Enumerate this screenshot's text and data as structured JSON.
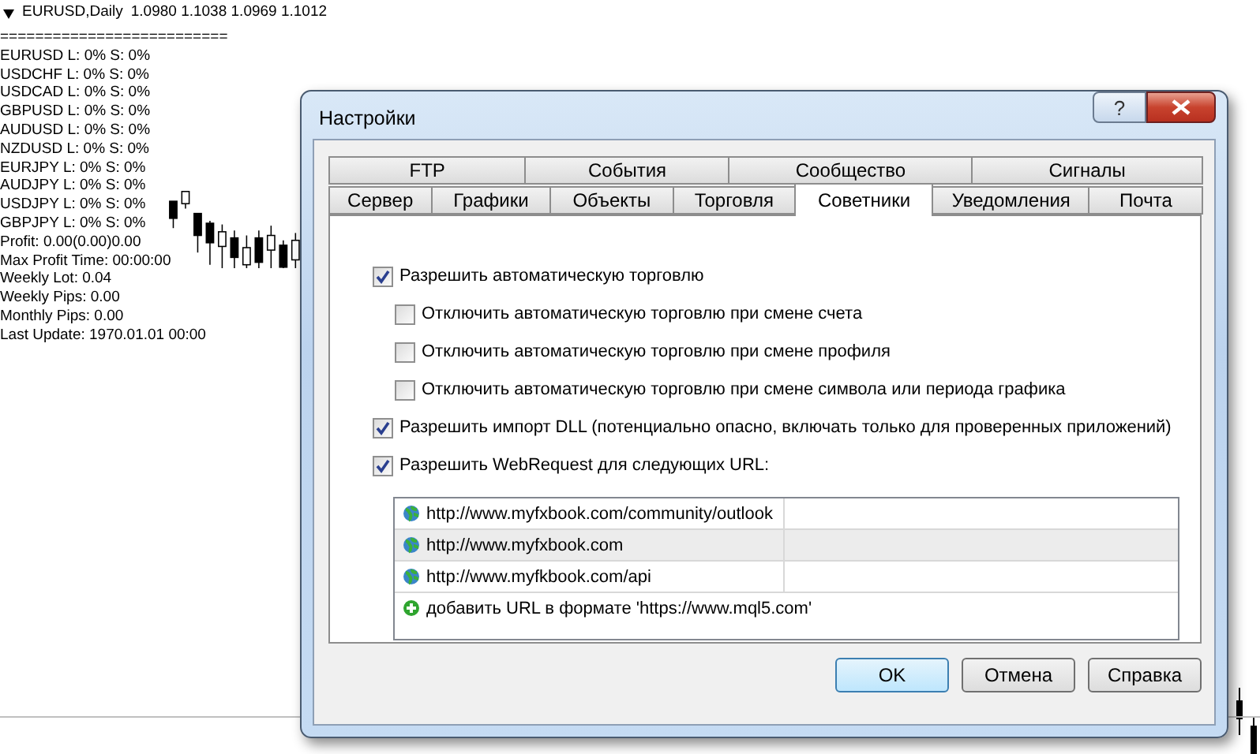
{
  "chart": {
    "symbol": "EURUSD,Daily",
    "prices": "1.0980 1.1038 1.0969 1.1012",
    "separator": "==========================",
    "lines": [
      "EURUSD L: 0% S: 0%",
      "USDCHF L: 0% S: 0%",
      "USDCAD L: 0% S: 0%",
      "GBPUSD L: 0% S: 0%",
      "AUDUSD L: 0% S: 0%",
      "NZDUSD L: 0% S: 0%",
      "EURJPY L: 0% S: 0%",
      "AUDJPY L: 0% S: 0%",
      "USDJPY L: 0% S: 0%",
      "GBPJPY L: 0% S: 0%",
      "Profit: 0.00(0.00)0.00",
      "Max Profit Time: 00:00:00",
      "Weekly Lot: 0.04",
      "Weekly Pips: 0.00",
      "Monthly Pips: 0.00",
      "Last Update: 1970.01.01 00:00"
    ]
  },
  "dialog": {
    "title": "Настройки",
    "help_glyph": "?",
    "tab_rows": [
      [
        {
          "label": "FTP",
          "selected": false
        },
        {
          "label": "События",
          "selected": false
        },
        {
          "label": "Сообщество",
          "selected": false
        },
        {
          "label": "Сигналы",
          "selected": false
        }
      ],
      [
        {
          "label": "Сервер",
          "selected": false
        },
        {
          "label": "Графики",
          "selected": false
        },
        {
          "label": "Объекты",
          "selected": false
        },
        {
          "label": "Торговля",
          "selected": false
        },
        {
          "label": "Советники",
          "selected": true
        },
        {
          "label": "Уведомления",
          "selected": false
        },
        {
          "label": "Почта",
          "selected": false
        }
      ]
    ],
    "options": [
      {
        "kind": "main",
        "label": "Разрешить автоматическую торговлю",
        "checked": true
      },
      {
        "kind": "sub",
        "label": "Отключить автоматическую торговлю при смене счета",
        "checked": false
      },
      {
        "kind": "sub",
        "label": "Отключить автоматическую торговлю при смене профиля",
        "checked": false
      },
      {
        "kind": "sub",
        "label": "Отключить автоматическую торговлю при смене символа или периода графика",
        "checked": false
      },
      {
        "kind": "main",
        "label": "Разрешить импорт DLL (потенциально опасно, включать только для проверенных приложений)",
        "checked": true
      },
      {
        "kind": "main",
        "label": "Разрешить WebRequest для следующих URL:",
        "checked": true
      }
    ],
    "urls": [
      {
        "text": "http://www.myfxbook.com/community/outlook",
        "selected": false
      },
      {
        "text": "http://www.myfxbook.com",
        "selected": true
      },
      {
        "text": "http://www.myfkbook.com/api",
        "selected": false
      }
    ],
    "add_url": "добавить URL в формате 'https://www.mql5.com'",
    "buttons": [
      {
        "label": "OK",
        "default": true
      },
      {
        "label": "Отмена",
        "default": false
      },
      {
        "label": "Справка",
        "default": false
      }
    ]
  }
}
